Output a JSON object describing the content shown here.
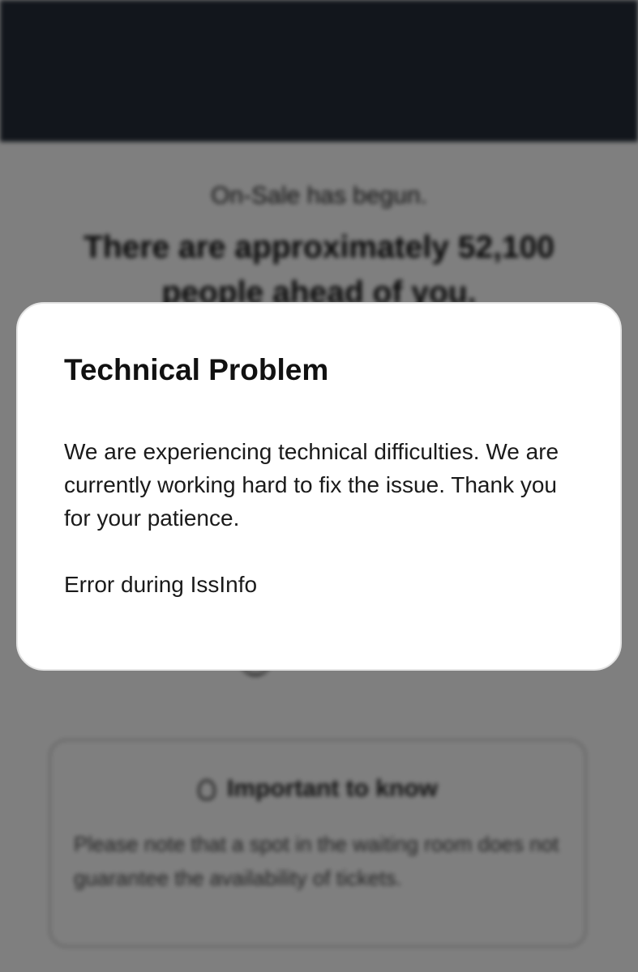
{
  "background_page": {
    "status_text": "On-Sale has begun.",
    "queue_message": "There are approximately 52,100 people ahead of you.",
    "info_box": {
      "heading": "Important to know",
      "text": "Please note that a spot in the waiting room does not guarantee the availability of tickets."
    }
  },
  "modal": {
    "title": "Technical Problem",
    "message": "We are experiencing technical difficulties. We are currently working hard to fix the issue. Thank you for your patience.",
    "error": "Error during IssInfo"
  },
  "colors": {
    "top_bar": "#242c38",
    "overlay": "rgba(0,0,0,0.5)",
    "modal_background": "#ffffff"
  }
}
